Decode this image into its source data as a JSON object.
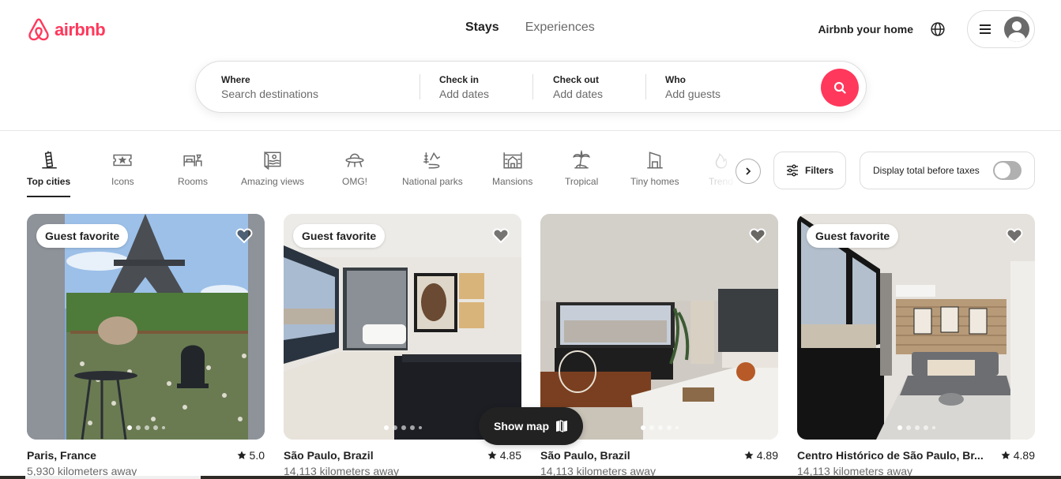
{
  "brand": {
    "name": "airbnb",
    "color": "#ff385c"
  },
  "header": {
    "tabs": [
      {
        "label": "Stays",
        "active": true
      },
      {
        "label": "Experiences",
        "active": false
      }
    ],
    "host_link": "Airbnb your home",
    "icons": {
      "globe": "globe-icon",
      "menu": "hamburger-menu-icon",
      "avatar": "user-avatar-icon"
    }
  },
  "search": {
    "where": {
      "label": "Where",
      "placeholder": "Search destinations"
    },
    "check_in": {
      "label": "Check in",
      "placeholder": "Add dates"
    },
    "check_out": {
      "label": "Check out",
      "placeholder": "Add dates"
    },
    "who": {
      "label": "Who",
      "placeholder": "Add guests"
    },
    "button_icon": "search-icon"
  },
  "categories": [
    {
      "label": "Top cities",
      "icon": "leaning-tower-icon",
      "active": true
    },
    {
      "label": "Icons",
      "icon": "ticket-star-icon",
      "active": false
    },
    {
      "label": "Rooms",
      "icon": "bed-lamp-icon",
      "active": false
    },
    {
      "label": "Amazing views",
      "icon": "picture-view-icon",
      "active": false
    },
    {
      "label": "OMG!",
      "icon": "ufo-icon",
      "active": false
    },
    {
      "label": "National parks",
      "icon": "mountain-trees-icon",
      "active": false
    },
    {
      "label": "Mansions",
      "icon": "mansion-icon",
      "active": false
    },
    {
      "label": "Tropical",
      "icon": "palm-tree-icon",
      "active": false
    },
    {
      "label": "Tiny homes",
      "icon": "tiny-home-icon",
      "active": false
    },
    {
      "label": "Trending",
      "icon": "flame-icon",
      "active": false
    }
  ],
  "toolbar": {
    "filters_label": "Filters",
    "taxes_label": "Display total before taxes",
    "taxes_toggle_on": false
  },
  "listings": [
    {
      "badge": "Guest favorite",
      "title": "Paris, France",
      "rating": "5.0",
      "distance": "5,930 kilometers away",
      "photos": 5,
      "current_photo": 1
    },
    {
      "badge": "Guest favorite",
      "title": "São Paulo, Brazil",
      "rating": "4.85",
      "distance": "14,113 kilometers away",
      "photos": 5,
      "current_photo": 1
    },
    {
      "badge": null,
      "title": "São Paulo, Brazil",
      "rating": "4.89",
      "distance": "14,113 kilometers away",
      "photos": 5,
      "current_photo": 1
    },
    {
      "badge": "Guest favorite",
      "title": "Centro Histórico de São Paulo, Br...",
      "rating": "4.89",
      "distance": "14,113 kilometers away",
      "photos": 5,
      "current_photo": 1
    }
  ],
  "show_map": {
    "label": "Show map",
    "icon": "map-icon"
  }
}
